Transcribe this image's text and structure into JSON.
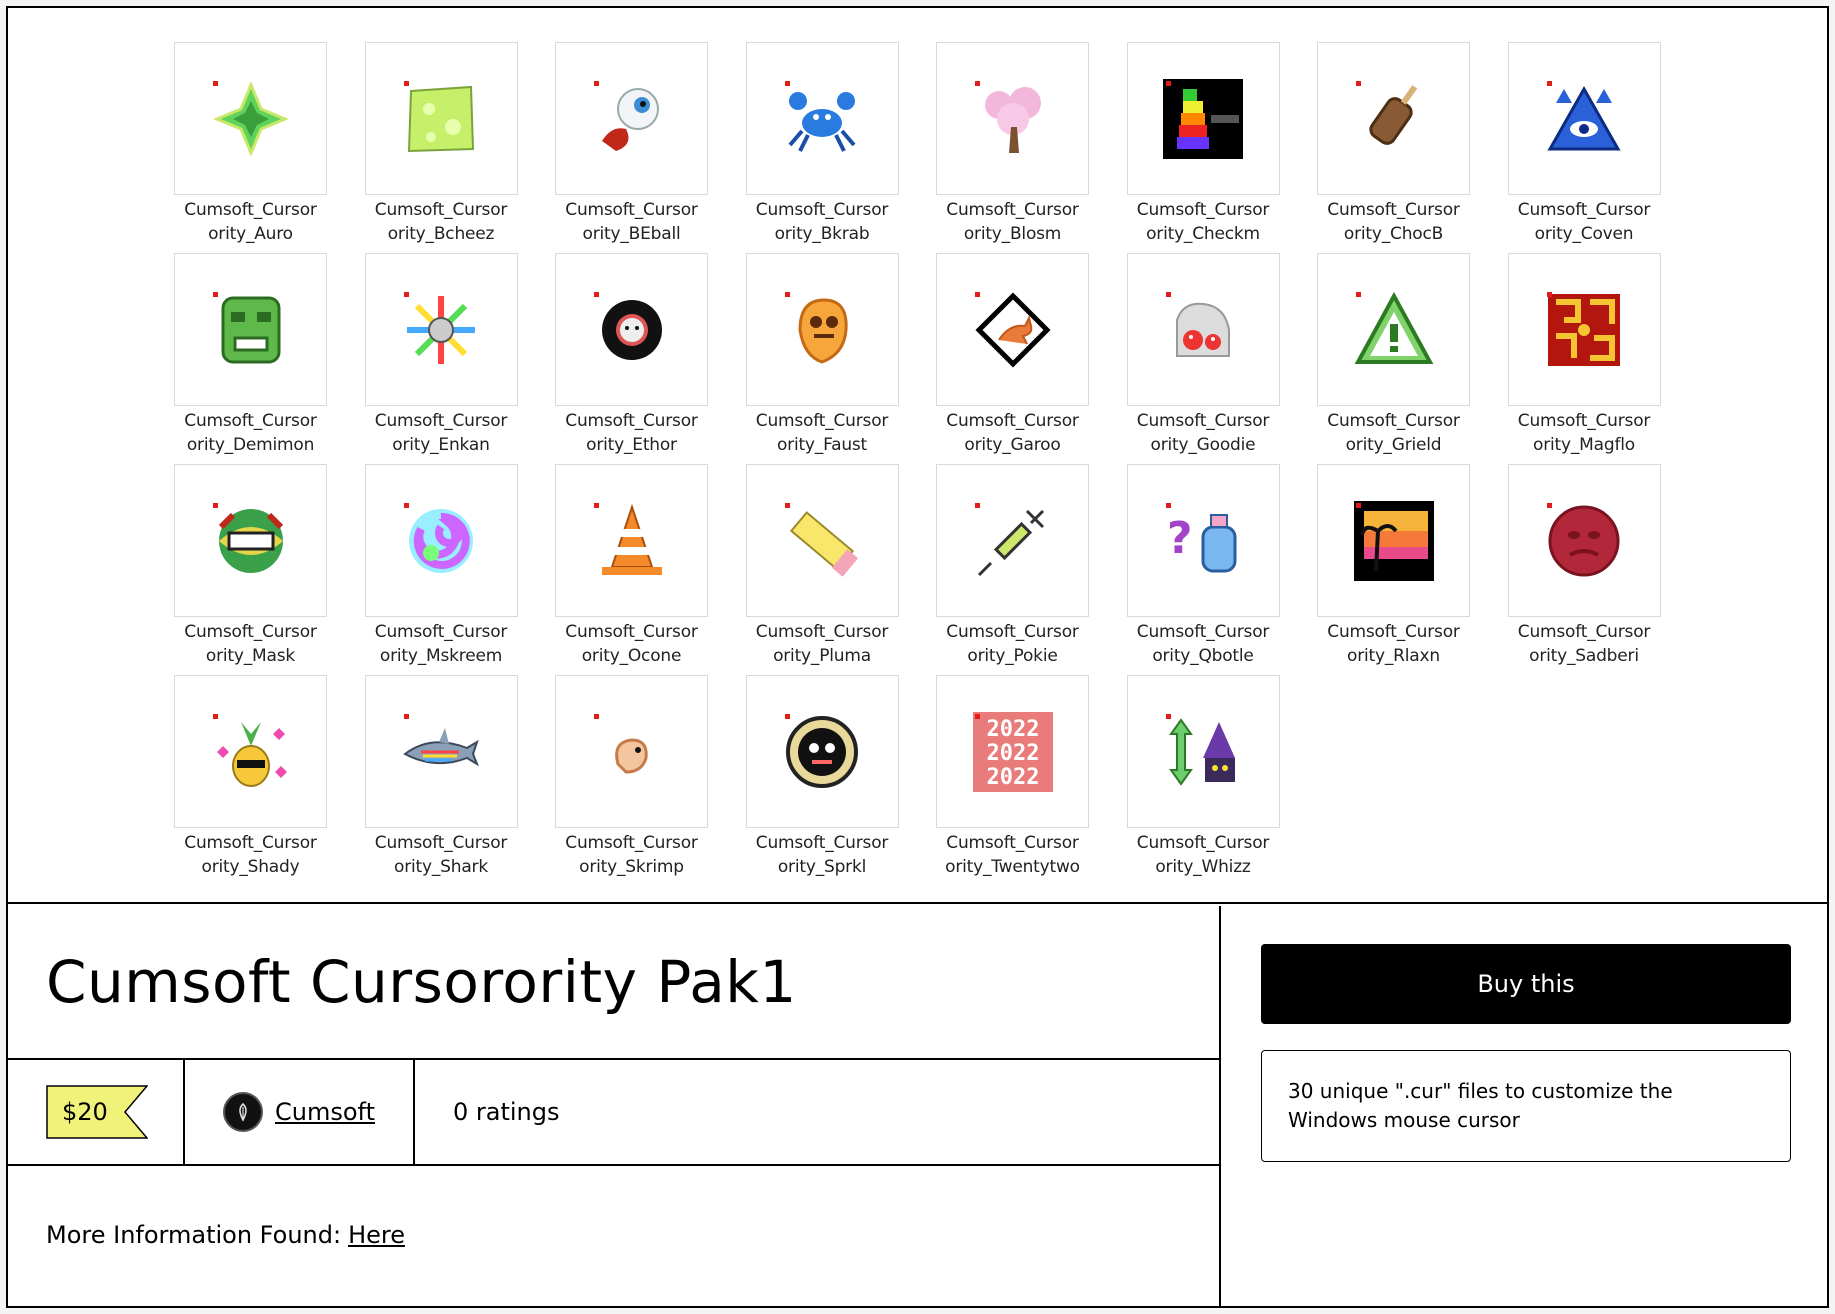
{
  "files": [
    {
      "l1": "Cumsoft_Cursor",
      "l2": "ority_Auro",
      "icon": "green-star-icon"
    },
    {
      "l1": "Cumsoft_Cursor",
      "l2": "ority_Bcheez",
      "icon": "cheese-icon"
    },
    {
      "l1": "Cumsoft_Cursor",
      "l2": "ority_BEball",
      "icon": "eyeball-icon"
    },
    {
      "l1": "Cumsoft_Cursor",
      "l2": "ority_Bkrab",
      "icon": "crab-icon"
    },
    {
      "l1": "Cumsoft_Cursor",
      "l2": "ority_Blosm",
      "icon": "blossom-tree-icon"
    },
    {
      "l1": "Cumsoft_Cursor",
      "l2": "ority_Checkm",
      "icon": "rainbow-tower-icon"
    },
    {
      "l1": "Cumsoft_Cursor",
      "l2": "ority_ChocB",
      "icon": "chocolate-bar-icon"
    },
    {
      "l1": "Cumsoft_Cursor",
      "l2": "ority_Coven",
      "icon": "pyramid-eye-icon"
    },
    {
      "l1": "Cumsoft_Cursor",
      "l2": "ority_Demimon",
      "icon": "green-idol-icon"
    },
    {
      "l1": "Cumsoft_Cursor",
      "l2": "ority_Enkan",
      "icon": "rainbow-sun-icon"
    },
    {
      "l1": "Cumsoft_Cursor",
      "l2": "ority_Ethor",
      "icon": "dark-face-icon"
    },
    {
      "l1": "Cumsoft_Cursor",
      "l2": "ority_Faust",
      "icon": "orange-ghost-icon"
    },
    {
      "l1": "Cumsoft_Cursor",
      "l2": "ority_Garoo",
      "icon": "kangaroo-sign-icon"
    },
    {
      "l1": "Cumsoft_Cursor",
      "l2": "ority_Goodie",
      "icon": "mushroom-bag-icon"
    },
    {
      "l1": "Cumsoft_Cursor",
      "l2": "ority_Grield",
      "icon": "warning-sign-icon"
    },
    {
      "l1": "Cumsoft_Cursor",
      "l2": "ority_Magflo",
      "icon": "red-maze-icon"
    },
    {
      "l1": "Cumsoft_Cursor",
      "l2": "ority_Mask",
      "icon": "mask-icon"
    },
    {
      "l1": "Cumsoft_Cursor",
      "l2": "ority_Mskreem",
      "icon": "swirl-icon"
    },
    {
      "l1": "Cumsoft_Cursor",
      "l2": "ority_Ocone",
      "icon": "traffic-cone-icon"
    },
    {
      "l1": "Cumsoft_Cursor",
      "l2": "ority_Pluma",
      "icon": "pencil-icon"
    },
    {
      "l1": "Cumsoft_Cursor",
      "l2": "ority_Pokie",
      "icon": "syringe-icon"
    },
    {
      "l1": "Cumsoft_Cursor",
      "l2": "ority_Qbotle",
      "icon": "question-bottle-icon"
    },
    {
      "l1": "Cumsoft_Cursor",
      "l2": "ority_Rlaxn",
      "icon": "sunset-palm-icon"
    },
    {
      "l1": "Cumsoft_Cursor",
      "l2": "ority_Sadberi",
      "icon": "red-face-icon"
    },
    {
      "l1": "Cumsoft_Cursor",
      "l2": "ority_Shady",
      "icon": "pineapple-hearts-icon"
    },
    {
      "l1": "Cumsoft_Cursor",
      "l2": "ority_Shark",
      "icon": "rainbow-shark-icon"
    },
    {
      "l1": "Cumsoft_Cursor",
      "l2": "ority_Skrimp",
      "icon": "shrimp-icon"
    },
    {
      "l1": "Cumsoft_Cursor",
      "l2": "ority_Sprkl",
      "icon": "sparkle-face-icon"
    },
    {
      "l1": "Cumsoft_Cursor",
      "l2": "ority_Twentytwo",
      "icon": "text-2022-icon"
    },
    {
      "l1": "Cumsoft_Cursor",
      "l2": "ority_Whizz",
      "icon": "wizard-arrow-icon"
    }
  ],
  "product": {
    "title": "Cumsoft Cursorority Pak1",
    "price": "$20",
    "seller": "Cumsoft",
    "ratings": "0 ratings",
    "info_label": "More Information Found:",
    "info_link": "Here",
    "buy_label": "Buy this",
    "summary": "30 unique \".cur\" files to customize the Windows mouse cursor"
  },
  "colors": {
    "price_tag": "#f0f27a",
    "button_bg": "#000000",
    "file_dot": "#e21b1b"
  },
  "icon_art": {
    "2022_text": "2022"
  }
}
